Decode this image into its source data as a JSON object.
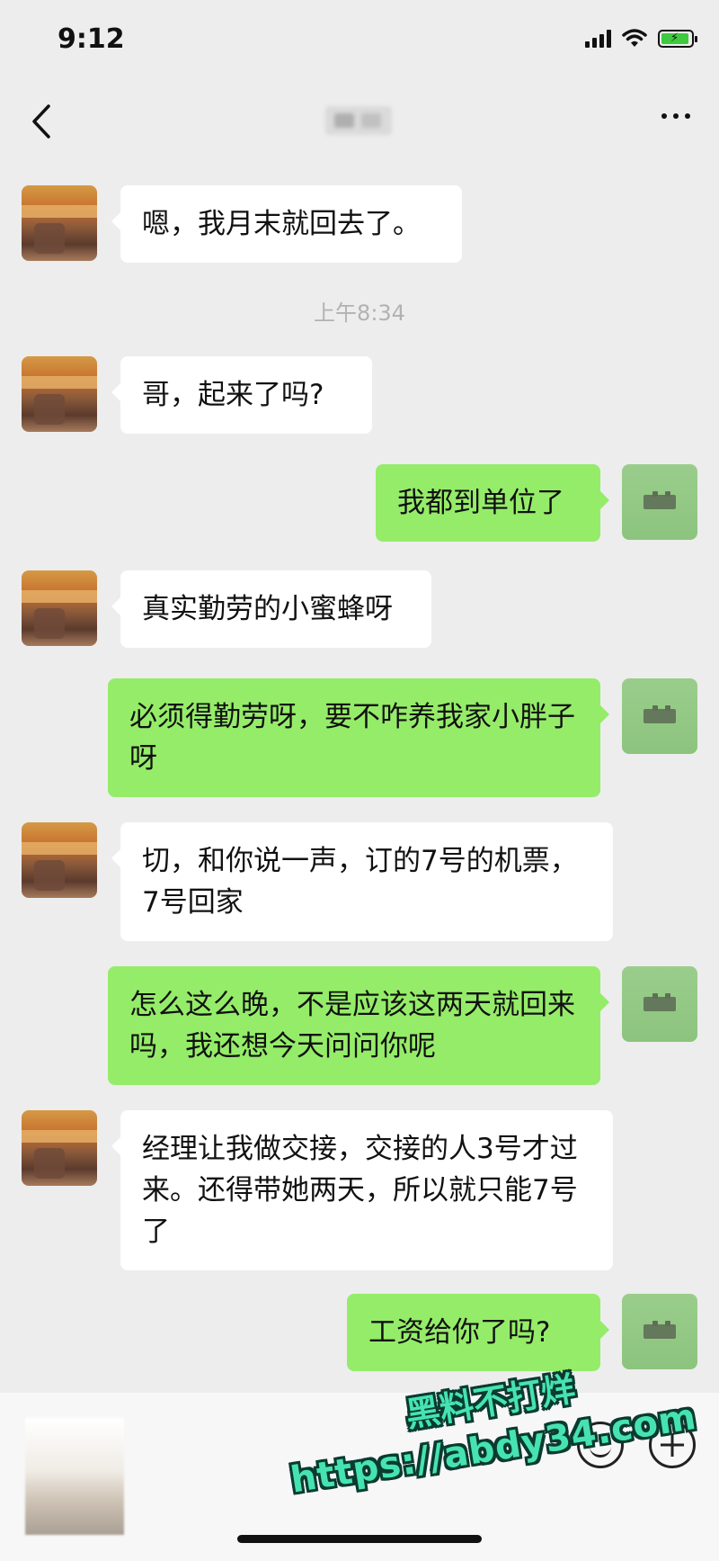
{
  "status_bar": {
    "time": "9:12"
  },
  "nav": {
    "back_icon": "chevron-left-icon",
    "more_icon": "more-dots-icon"
  },
  "timestamp": "上午8:34",
  "messages": [
    {
      "side": "left",
      "text": "嗯，我月末就回去了。"
    },
    {
      "side": "left",
      "text": "哥，起来了吗?"
    },
    {
      "side": "right",
      "text": "我都到单位了"
    },
    {
      "side": "left",
      "text": "真实勤劳的小蜜蜂呀"
    },
    {
      "side": "right",
      "text": "必须得勤劳呀，要不咋养我家小胖子呀"
    },
    {
      "side": "left",
      "text": "切，和你说一声，订的7号的机票，7号回家"
    },
    {
      "side": "right",
      "text": "怎么这么晚，不是应该这两天就回来吗，我还想今天问问你呢"
    },
    {
      "side": "left",
      "text": "经理让我做交接，交接的人3号才过来。还得带她两天，所以就只能7号了"
    },
    {
      "side": "right",
      "text": "工资给你了吗?"
    }
  ],
  "watermark": {
    "title": "黑料不打烊",
    "url": "https://abdy34.com"
  },
  "colors": {
    "background": "#ededed",
    "bubble_left": "#ffffff",
    "bubble_right": "#95ec69",
    "watermark": "#46e3b0"
  }
}
